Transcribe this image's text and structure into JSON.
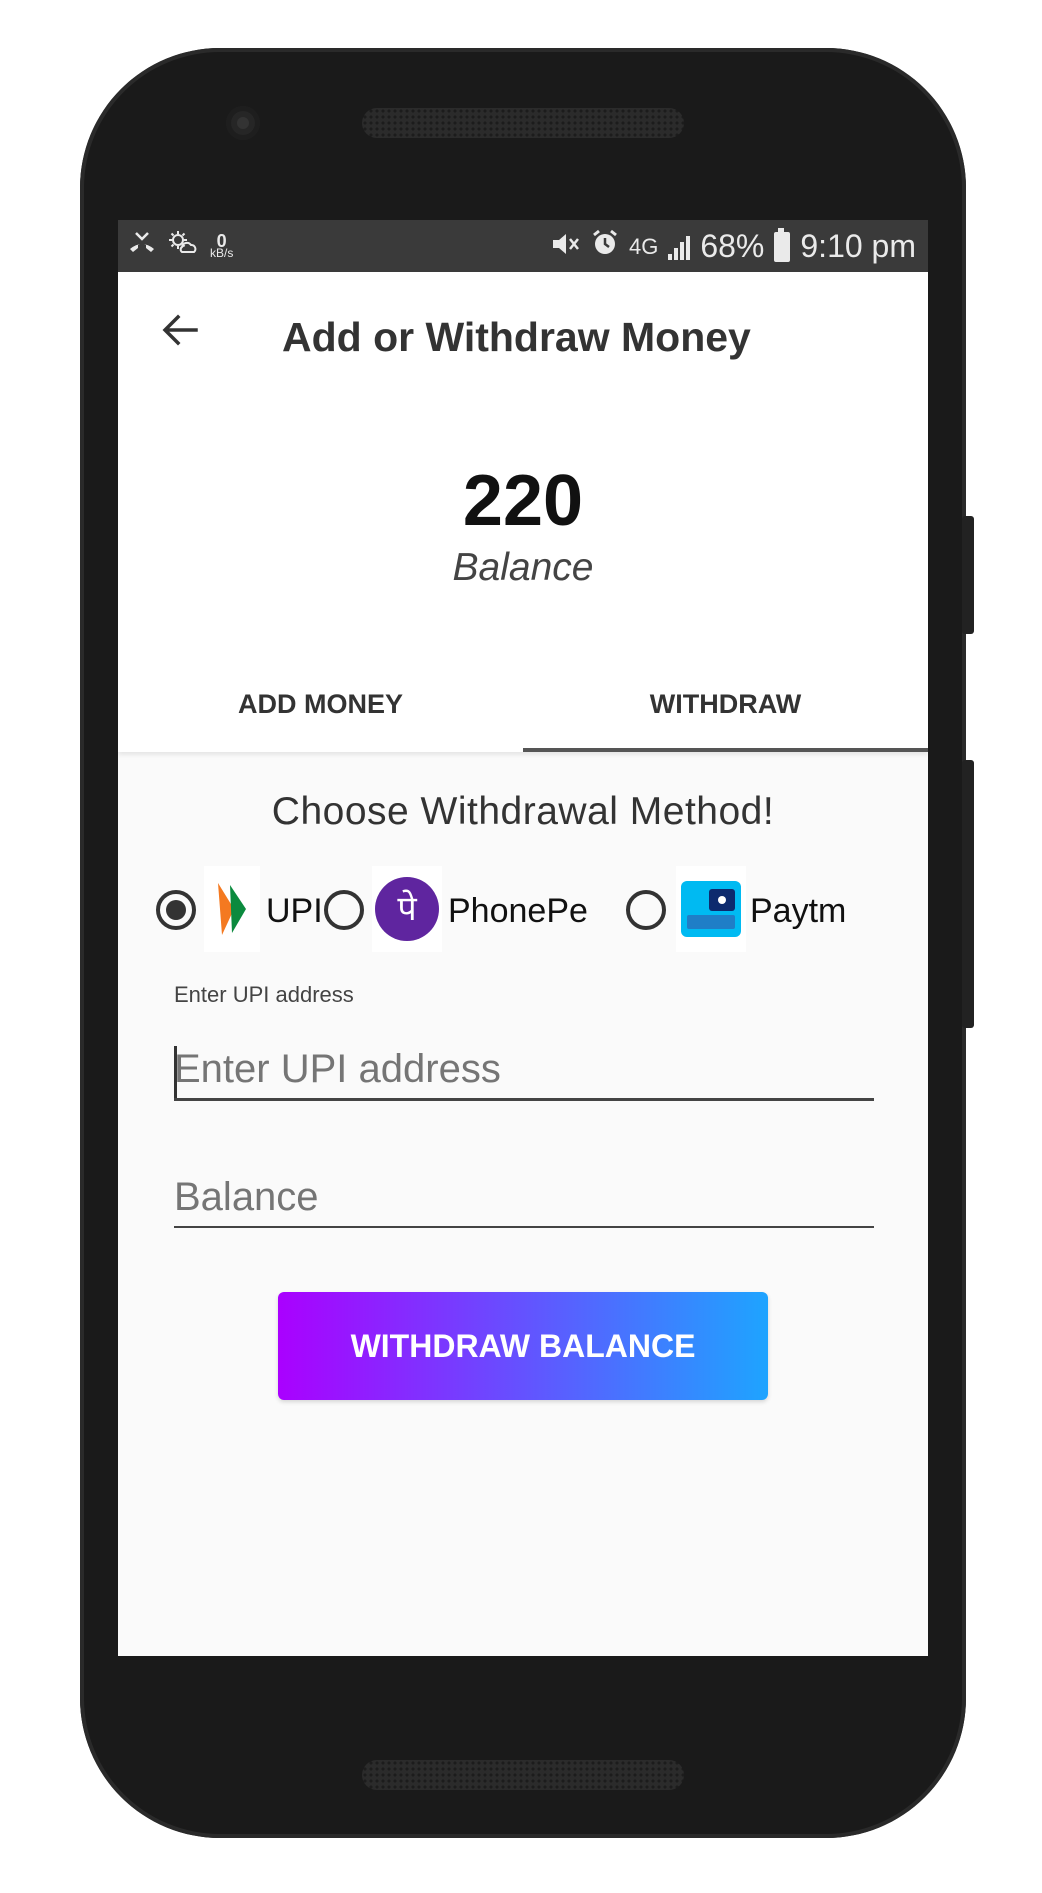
{
  "status_bar": {
    "data_speed": "0",
    "data_unit": "kB/s",
    "network": "4G",
    "battery": "68%",
    "time": "9:10 pm",
    "icons": [
      "missed-call-icon",
      "weather-icon",
      "mute-icon",
      "alarm-icon",
      "signal-icon",
      "battery-icon"
    ]
  },
  "header": {
    "title": "Add or Withdraw Money",
    "back_icon": "back-arrow-icon"
  },
  "balance": {
    "value": "220",
    "label": "Balance"
  },
  "tabs": [
    {
      "label": "ADD MONEY",
      "active": false
    },
    {
      "label": "WITHDRAW",
      "active": true
    }
  ],
  "withdraw": {
    "heading": "Choose Withdrawal Method!",
    "methods": [
      {
        "label": "UPI",
        "selected": true,
        "icon": "upi-logo-icon"
      },
      {
        "label": "PhonePe",
        "selected": false,
        "icon": "phonepe-logo-icon"
      },
      {
        "label": "Paytm",
        "selected": false,
        "icon": "paytm-logo-icon"
      }
    ],
    "upi_field_label": "Enter UPI address",
    "upi_placeholder": "Enter UPI address",
    "balance_placeholder": "Balance",
    "button_label": "WITHDRAW BALANCE"
  },
  "colors": {
    "button_gradient_start": "#aa00ff",
    "button_gradient_end": "#1ea4ff",
    "phonepe_purple": "#5f259f",
    "paytm_blue": "#00baf2"
  }
}
